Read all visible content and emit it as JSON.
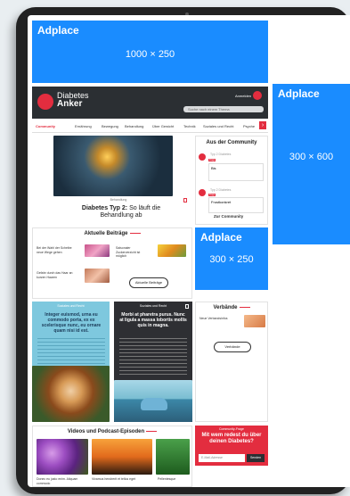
{
  "ads": {
    "top": {
      "label": "Adplace",
      "size": "1000 × 250"
    },
    "side": {
      "label": "Adplace",
      "size": "300 × 600"
    },
    "mid": {
      "label": "Adplace",
      "size": "300 × 250"
    }
  },
  "header": {
    "logo_line1": "Diabetes",
    "logo_line2": "Anker",
    "logo_sub": "Diabetes-Anker.de",
    "search_placeholder": "Suche nach einem Thema",
    "user_label": "Anmelden"
  },
  "nav": {
    "items": [
      "Community",
      "Ernährung",
      "Bewegung",
      "Behandlung",
      "Über Gewicht",
      "Technik",
      "Soziales und Recht",
      "Psyche"
    ]
  },
  "hero": {
    "category": "Behandlung",
    "title_bold": "Diabetes Typ 2:",
    "title_rest": " So läuft die Behandlung ab"
  },
  "community": {
    "title": "Aus der Community",
    "post1": {
      "user": "Typ 2 Diabetes",
      "tag": "Frage",
      "text": "Bis"
    },
    "post2": {
      "user": "Typ 2 Diabetes",
      "tag": "Frage",
      "text": "Frustkonkret"
    },
    "button": "Zur Community"
  },
  "beitraege": {
    "title": "Aktuelle Beiträge",
    "item1": "Bei der Wahl der Scheibe neue Wege gehen",
    "item2": "Saisonaler Zuckerverzicht ist möglich",
    "item3": "Gefahr durch das Haar an kurzen Haaren",
    "button": "Aktuelle Beiträge"
  },
  "soziales1": {
    "label": "Soziales und Recht",
    "title": "Integer euismod, urna eu commodo porta, ex ex scelerisque nunc, eu ornare quam nisi id est."
  },
  "soziales2": {
    "label": "Soziales und Recht",
    "title": "Morbi at pharetra purus. Nunc at ligula a massa lobortis mollis quis in magna."
  },
  "verbaende": {
    "title": "Verbände",
    "item": "Neue Verbandsinfos",
    "button": "Verbände"
  },
  "videos": {
    "title": "Videos und Podcast-Episoden",
    "item1": "Donec eu justo enim. Aliquam commodo",
    "item2": "Vivamus hendrerit et tellus eget",
    "item3": "Pellentesque"
  },
  "newsletter": {
    "label": "Community-Frage",
    "title": "Mit wem redest du über deinen Diabetes?",
    "input_placeholder": "E-Mail-Adresse",
    "button": "Senden"
  }
}
